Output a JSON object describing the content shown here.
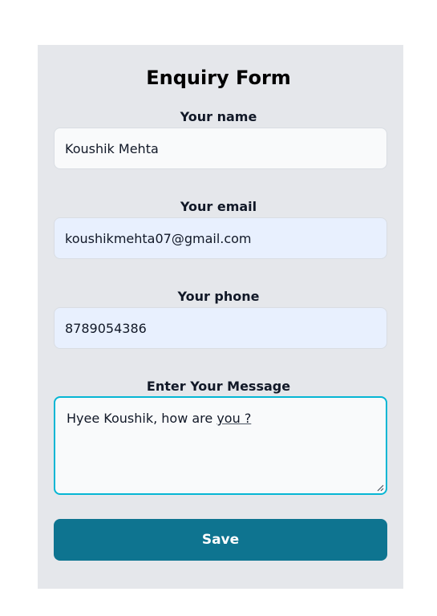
{
  "form": {
    "title": "Enquiry Form",
    "name": {
      "label": "Your name",
      "value": "Koushik Mehta"
    },
    "email": {
      "label": "Your email",
      "value": "koushikmehta07@gmail.com"
    },
    "phone": {
      "label": "Your phone",
      "value": "8789054386"
    },
    "message": {
      "label": "Enter Your Message",
      "value_prefix": "Hyee Koushik, how are ",
      "value_spell": "you ?"
    },
    "save_label": "Save"
  },
  "colors": {
    "panel": "#e5e7eb",
    "input_bg": "#f9fafb",
    "autofill_bg": "#e8f0fe",
    "focus_border": "#06b6d4",
    "button_bg": "#0e7490"
  },
  "icons": {
    "textarea_resize": "resize-handle-icon"
  }
}
